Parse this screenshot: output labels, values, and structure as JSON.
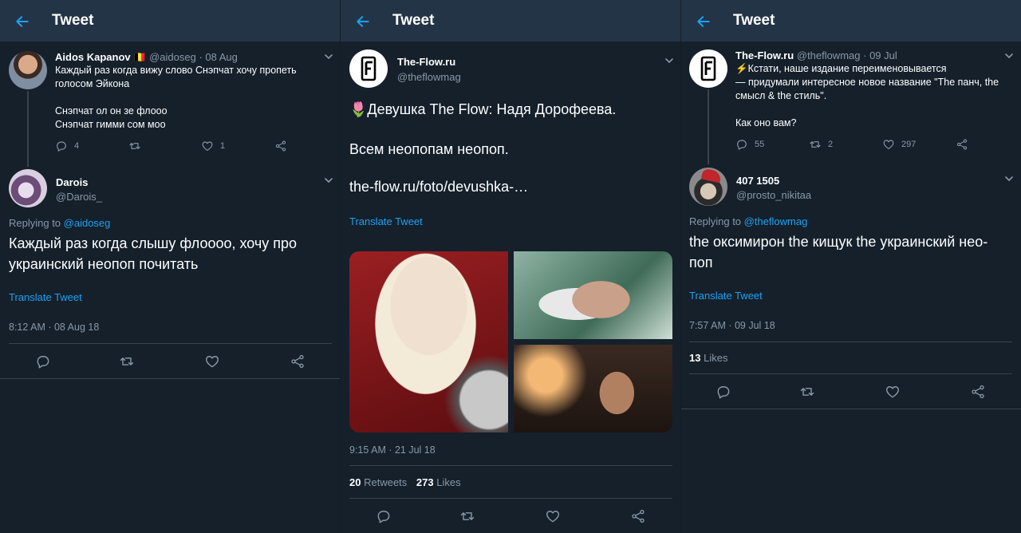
{
  "header": {
    "title": "Tweet"
  },
  "panel1": {
    "parent": {
      "name": "Aidos Kapanov",
      "flag": "🇧🇪",
      "handle": "@aidoseg",
      "date": "· 08 Aug",
      "line1": "Каждый раз когда вижу слово Снэпчат хочу пропеть",
      "line2": "голосом Эйкона",
      "line3": "Снэпчат ол он зе флооо",
      "line4": "Снэпчат гимми сом моо",
      "replies": "4",
      "likes": "1"
    },
    "main": {
      "name": "Darois",
      "handle": "@Darois_",
      "replying_prefix": "Replying to ",
      "replying_to": "@aidoseg",
      "text": "Каждый раз когда слышу флоооо, хочу про украинский неопоп почитать",
      "translate": "Translate Tweet",
      "timestamp": "8:12 AM · 08 Aug 18"
    }
  },
  "panel2": {
    "main": {
      "name": "The-Flow.ru",
      "handle": "@theflowmag",
      "line1": "🌷Девушка The Flow: Надя Дорофеева.",
      "line2": "Всем неопопам неопоп.",
      "url": "the-flow.ru/foto/devushka-…",
      "translate": "Translate Tweet",
      "timestamp": "9:15 AM · 21 Jul 18",
      "retweets_count": "20",
      "retweets_label": "Retweets",
      "likes_count": "273",
      "likes_label": "Likes"
    }
  },
  "panel3": {
    "parent": {
      "name": "The-Flow.ru",
      "handle": "@theflowmag",
      "date": "· 09 Jul",
      "line1": "⚡Кстати, наше издание переименовывается",
      "line2": "— придумали интересное новое название \"The панч, the",
      "line3": "смысл & the стиль\".",
      "line4": "Как оно вам?",
      "replies": "55",
      "retweets": "2",
      "likes": "297"
    },
    "main": {
      "name": "407 1505",
      "handle": "@prosto_nikitaa",
      "replying_prefix": "Replying to ",
      "replying_to": "@theflowmag",
      "text": "the оксимирон the кищук the украинский нео-поп",
      "translate": "Translate Tweet",
      "timestamp": "7:57 AM · 09 Jul 18",
      "likes_count": "13",
      "likes_label": "Likes"
    }
  },
  "colors": {
    "accent": "#1da1f2",
    "background": "#15202b",
    "header": "#243447",
    "muted": "#8899a6",
    "divider": "#38444d"
  },
  "icons": [
    "back-arrow-icon",
    "chevron-down-icon",
    "reply-icon",
    "retweet-icon",
    "like-icon",
    "share-icon"
  ]
}
